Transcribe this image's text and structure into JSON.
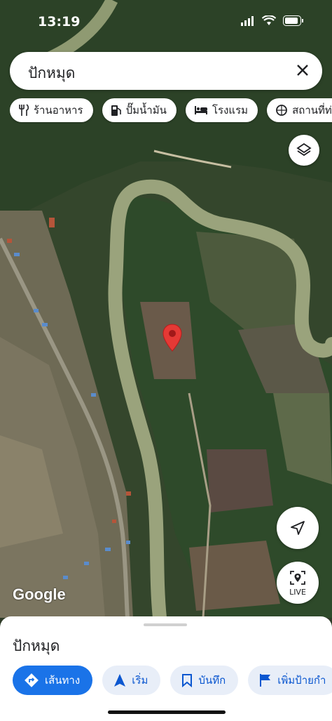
{
  "status_bar": {
    "time": "13:19"
  },
  "search": {
    "query": "ปักหมุด"
  },
  "categories": [
    {
      "label": "ร้านอาหาร",
      "icon": "restaurant-icon"
    },
    {
      "label": "ปั๊มน้ำมัน",
      "icon": "gas-station-icon"
    },
    {
      "label": "โรงแรม",
      "icon": "hotel-icon"
    },
    {
      "label": "สถานที่ท่องเที่",
      "icon": "attraction-icon"
    }
  ],
  "map": {
    "attribution": "Google",
    "live_label": "LIVE",
    "pin_color": "#e53935"
  },
  "sheet": {
    "title": "ปักหมุด",
    "actions": [
      {
        "label": "เส้นทาง",
        "icon": "directions-icon"
      },
      {
        "label": "เริ่ม",
        "icon": "navigation-arrow-icon"
      },
      {
        "label": "บันทึก",
        "icon": "bookmark-icon"
      },
      {
        "label": "เพิ่มป้ายกำ",
        "icon": "flag-icon"
      }
    ]
  },
  "colors": {
    "accent": "#1a73e8",
    "chip_text": "#0b57d0"
  }
}
